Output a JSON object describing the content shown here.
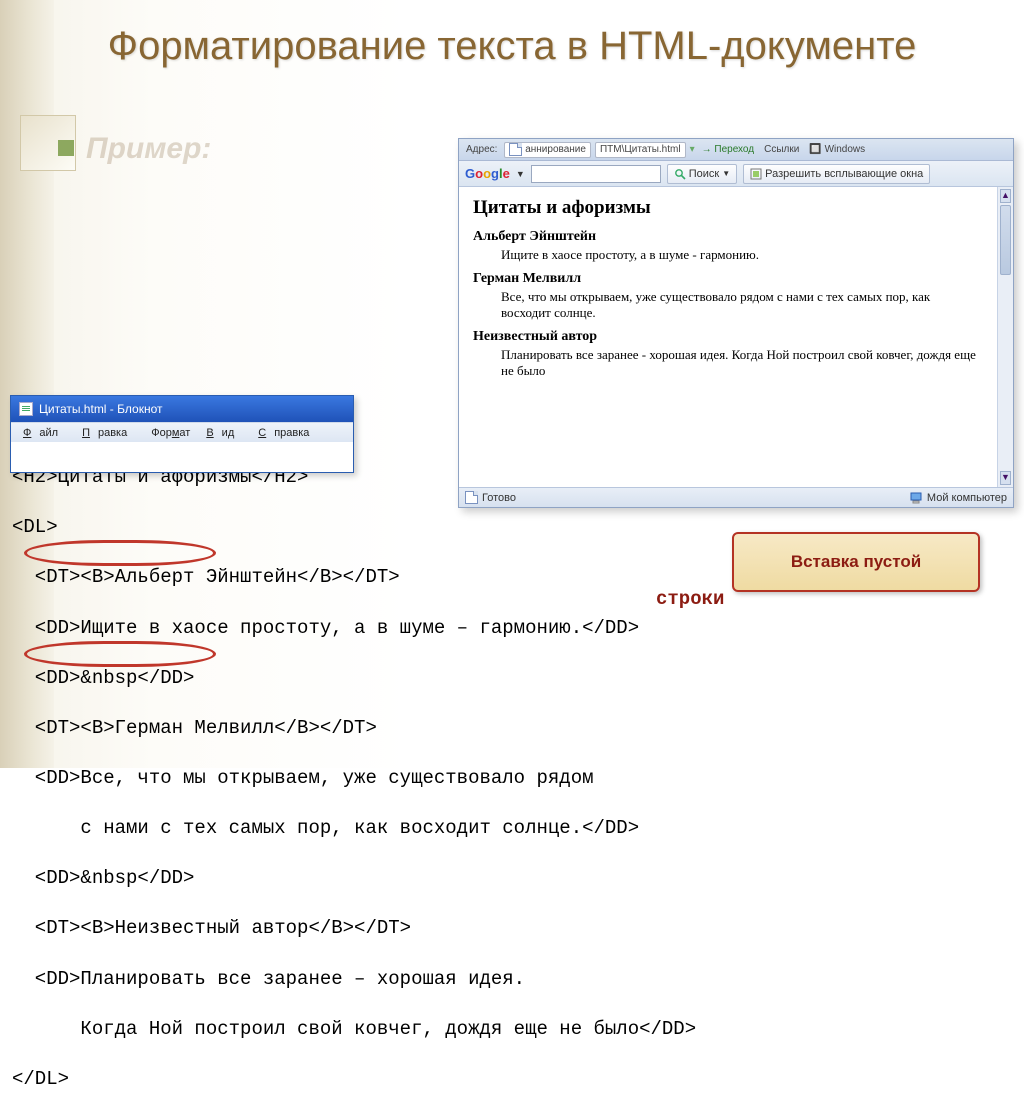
{
  "slide": {
    "title": "Форматирование текста в HTML-документе",
    "example_label": "Пример:"
  },
  "callout": {
    "line1": "Вставка пустой",
    "line2": "строки"
  },
  "browser": {
    "addressbar": {
      "tab_label": "аннирование",
      "path_label": "ПТМ\\Цитаты.html",
      "go_label": "Переход",
      "links_label": "Ссылки",
      "win_label": "Windows"
    },
    "toolbar": {
      "search_label": "Поиск",
      "popup_label": "Разрешить всплывающие окна"
    },
    "content": {
      "heading": "Цитаты и афоризмы",
      "items": [
        {
          "author": "Альберт Эйнштейн",
          "text": "Ищите в хаосе простоту, а в шуме - гармонию."
        },
        {
          "author": "Герман Мелвилл",
          "text": "Все, что мы открываем, уже существовало рядом с нами с тех самых пор, как восходит солнце."
        },
        {
          "author": "Неизвестный автор",
          "text": "Планировать все заранее - хорошая идея. Когда Ной построил свой ковчег, дождя еще не было"
        }
      ]
    },
    "status": {
      "ready": "Готово",
      "zone": "Мой компьютер"
    }
  },
  "notepad": {
    "title": "Цитаты.html - Блокнот",
    "menu": {
      "file": "Файл",
      "edit": "Правка",
      "format": "Формат",
      "view": "Вид",
      "help": "Справка"
    }
  },
  "code": {
    "l0": "<H2>Цитаты и афоризмы</H2>",
    "l1": "<DL>",
    "l2": "  <DT><B>Альберт Эйнштейн</B></DT>",
    "l3": "  <DD>Ищите в хаосе простоту, а в шуме – гармонию.</DD>",
    "l4": "  <DD>&nbsp</DD>",
    "l5": "  <DT><B>Герман Мелвилл</B></DT>",
    "l6": "  <DD>Все, что мы открываем, уже существовало рядом",
    "l7": "      с нами с тех самых пор, как восходит солнце.</DD>",
    "l8": "  <DD>&nbsp</DD>",
    "l9": "  <DT><B>Неизвестный автор</B></DT>",
    "l10": "  <DD>Планировать все заранее – хорошая идея.",
    "l11": "      Когда Ной построил свой ковчег, дождя еще не было</DD>",
    "l12": "</DL>"
  }
}
